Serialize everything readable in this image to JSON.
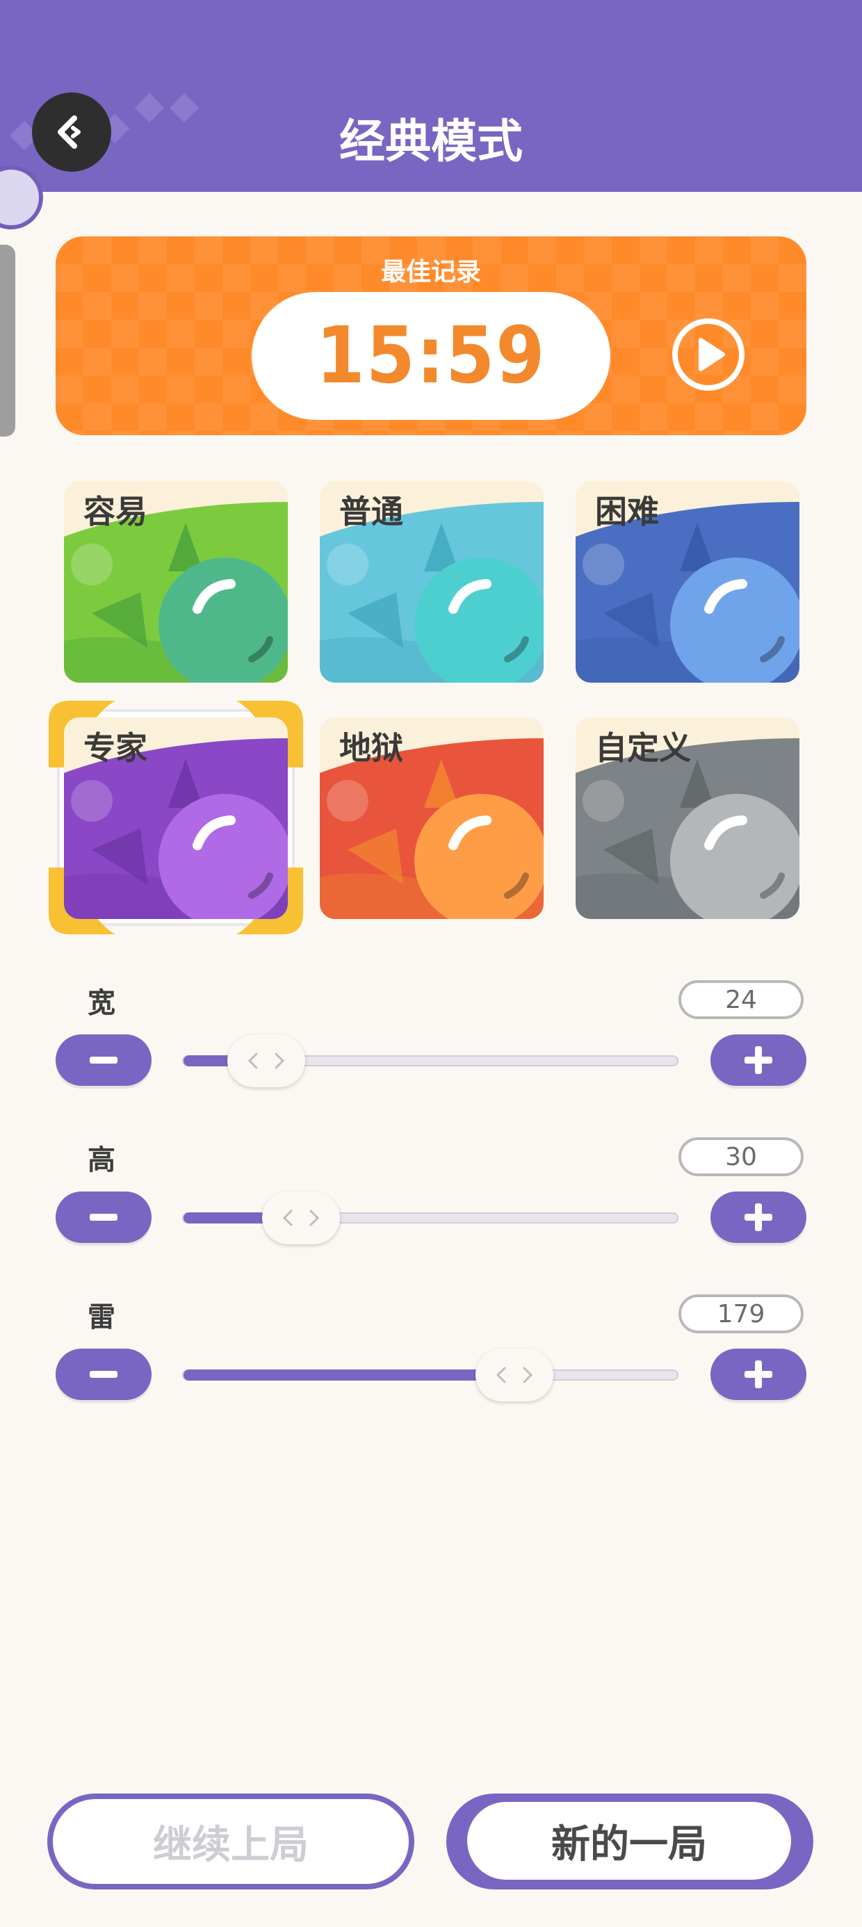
{
  "header": {
    "title": "经典模式"
  },
  "record": {
    "label": "最佳记录",
    "time": "15:59"
  },
  "difficulties": [
    {
      "label": "容易",
      "selected": false,
      "color": "#5fb94a"
    },
    {
      "label": "普通",
      "selected": false,
      "color": "#56bfd2"
    },
    {
      "label": "困难",
      "selected": false,
      "color": "#4a74c8"
    },
    {
      "label": "专家",
      "selected": true,
      "color": "#8b4cc9"
    },
    {
      "label": "地狱",
      "selected": false,
      "color": "#e8543b"
    },
    {
      "label": "自定义",
      "selected": false,
      "color": "#7f8487"
    }
  ],
  "sliders": [
    {
      "label": "宽",
      "value": "24",
      "fraction": 0.17
    },
    {
      "label": "高",
      "value": "30",
      "fraction": 0.24
    },
    {
      "label": "雷",
      "value": "179",
      "fraction": 0.67
    }
  ],
  "buttons": {
    "continue": "继续上局",
    "new_game": "新的一局"
  },
  "icons": {
    "back": "back-arrow-icon",
    "play": "play-icon",
    "minus": "minus-icon",
    "plus": "plus-icon",
    "thumb": "drag-handle-icon"
  },
  "colors": {
    "accent": "#7866c2",
    "record": "#ff8a2a",
    "highlight": "#f8c033"
  }
}
